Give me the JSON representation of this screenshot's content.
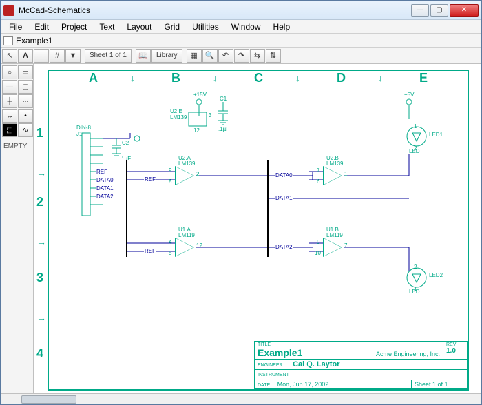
{
  "window": {
    "title": "McCad-Schematics"
  },
  "menu": [
    "File",
    "Edit",
    "Project",
    "Text",
    "Layout",
    "Grid",
    "Utilities",
    "Window",
    "Help"
  ],
  "doc_tab": "Example1",
  "toolbar": {
    "sheet": "Sheet 1 of 1",
    "library": "Library"
  },
  "sidebar": {
    "empty": "EMPTY"
  },
  "grid": {
    "cols": [
      "A",
      "B",
      "C",
      "D",
      "E"
    ],
    "rows": [
      "1",
      "2",
      "3",
      "4"
    ]
  },
  "title_block": {
    "title_label": "TITLE",
    "title": "Example1",
    "company": "Acme Engineering, Inc.",
    "rev_label": "REV",
    "rev": "1.0",
    "engineer_label": "ENGINEER",
    "engineer": "Cal Q. Laytor",
    "instrument_label": "INSTRUMENT",
    "date_label": "DATE",
    "date": "Mon, Jun 17, 2002",
    "sheet": "Sheet 1 of 1"
  },
  "components": {
    "power1": "+15V",
    "power2": "+5V",
    "conn": {
      "ref": "J1",
      "type": "DIN-8"
    },
    "c1": {
      "ref": "C1",
      "val": ".1µF"
    },
    "c2": {
      "ref": "C2",
      "val": ".1µF"
    },
    "u2e": {
      "ref": "U2.E",
      "part": "LM139",
      "pin_a": "3",
      "pin_b": "12"
    },
    "u2a": {
      "ref": "U2.A",
      "part": "LM139",
      "pin_p": "9",
      "pin_n": "8",
      "pin_o": "2"
    },
    "u2b": {
      "ref": "U2.B",
      "part": "LM139",
      "pin_p": "7",
      "pin_n": "6",
      "pin_o": "1"
    },
    "u1a": {
      "ref": "U1.A",
      "part": "LM119",
      "pin_p": "4",
      "pin_n": "5",
      "pin_o": "12"
    },
    "u1b": {
      "ref": "U1.B",
      "part": "LM119",
      "pin_p": "9",
      "pin_n": "10",
      "pin_o": "7"
    },
    "led1": {
      "ref": "LED1",
      "type": "LED",
      "pin_a": "1",
      "pin_k": "2"
    },
    "led2": {
      "ref": "LED2",
      "type": "LED",
      "pin_a": "2",
      "pin_k": "1"
    }
  },
  "nets": {
    "ref": "REF",
    "data0": "DATA0",
    "data1": "DATA1",
    "data2": "DATA2"
  }
}
